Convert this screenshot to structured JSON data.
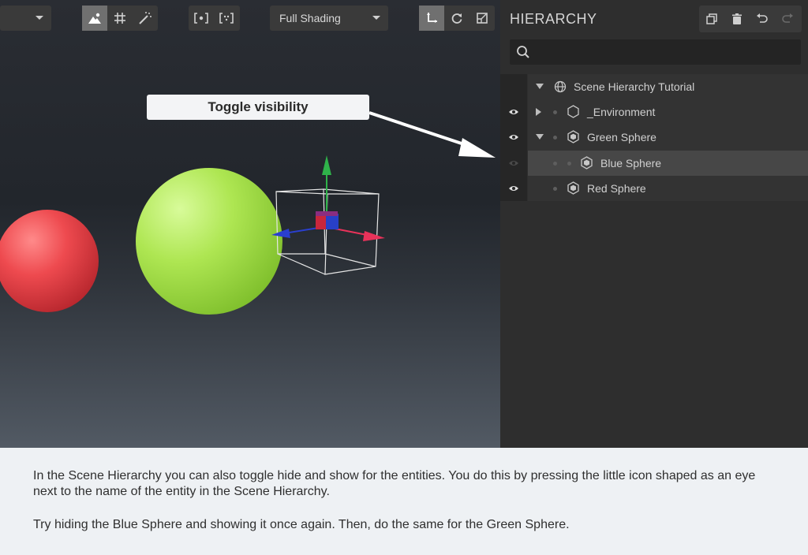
{
  "toolbar": {
    "left_dropdown_value": "",
    "shading_dropdown_value": "Full Shading",
    "group1": [
      "scene-icon",
      "grid-icon",
      "magic-wand-icon"
    ],
    "group2": [
      "frame-selected-icon",
      "frame-all-icon"
    ],
    "group3": [
      "move-icon",
      "rotate-icon",
      "scale-icon"
    ]
  },
  "callout": {
    "text": "Toggle visibility"
  },
  "hierarchy": {
    "title": "HIERARCHY",
    "actions": [
      "duplicate-icon",
      "delete-icon",
      "undo-icon",
      "redo-icon"
    ],
    "search_placeholder": "",
    "tree": [
      {
        "label": "Scene Hierarchy Tutorial",
        "icon": "globe-icon",
        "expanded": true,
        "visible": null,
        "selected": false
      },
      {
        "label": "_Environment",
        "icon": "hexagon-icon",
        "expanded": false,
        "visible": true,
        "selected": false
      },
      {
        "label": "Green Sphere",
        "icon": "cube-icon",
        "expanded": true,
        "visible": true,
        "selected": false
      },
      {
        "label": "Blue Sphere",
        "icon": "cube-icon",
        "expanded": null,
        "visible": false,
        "selected": true
      },
      {
        "label": "Red Sphere",
        "icon": "cube-icon",
        "expanded": null,
        "visible": true,
        "selected": false
      }
    ]
  },
  "instructions": {
    "paragraph1": "In the Scene Hierarchy you can also toggle hide and show for the entities. You do this by pressing the little icon shaped as an eye next to the name of the entity in the Scene Hierarchy.",
    "paragraph2": "Try hiding the Blue Sphere and showing it once again. Then, do the same for the Green Sphere."
  },
  "colors": {
    "red_sphere": "#e8454a",
    "green_sphere": "#a6e24a",
    "gizmo_green": "#2fb34a",
    "gizmo_red": "#e8325a",
    "gizmo_blue": "#2a3fcf"
  }
}
